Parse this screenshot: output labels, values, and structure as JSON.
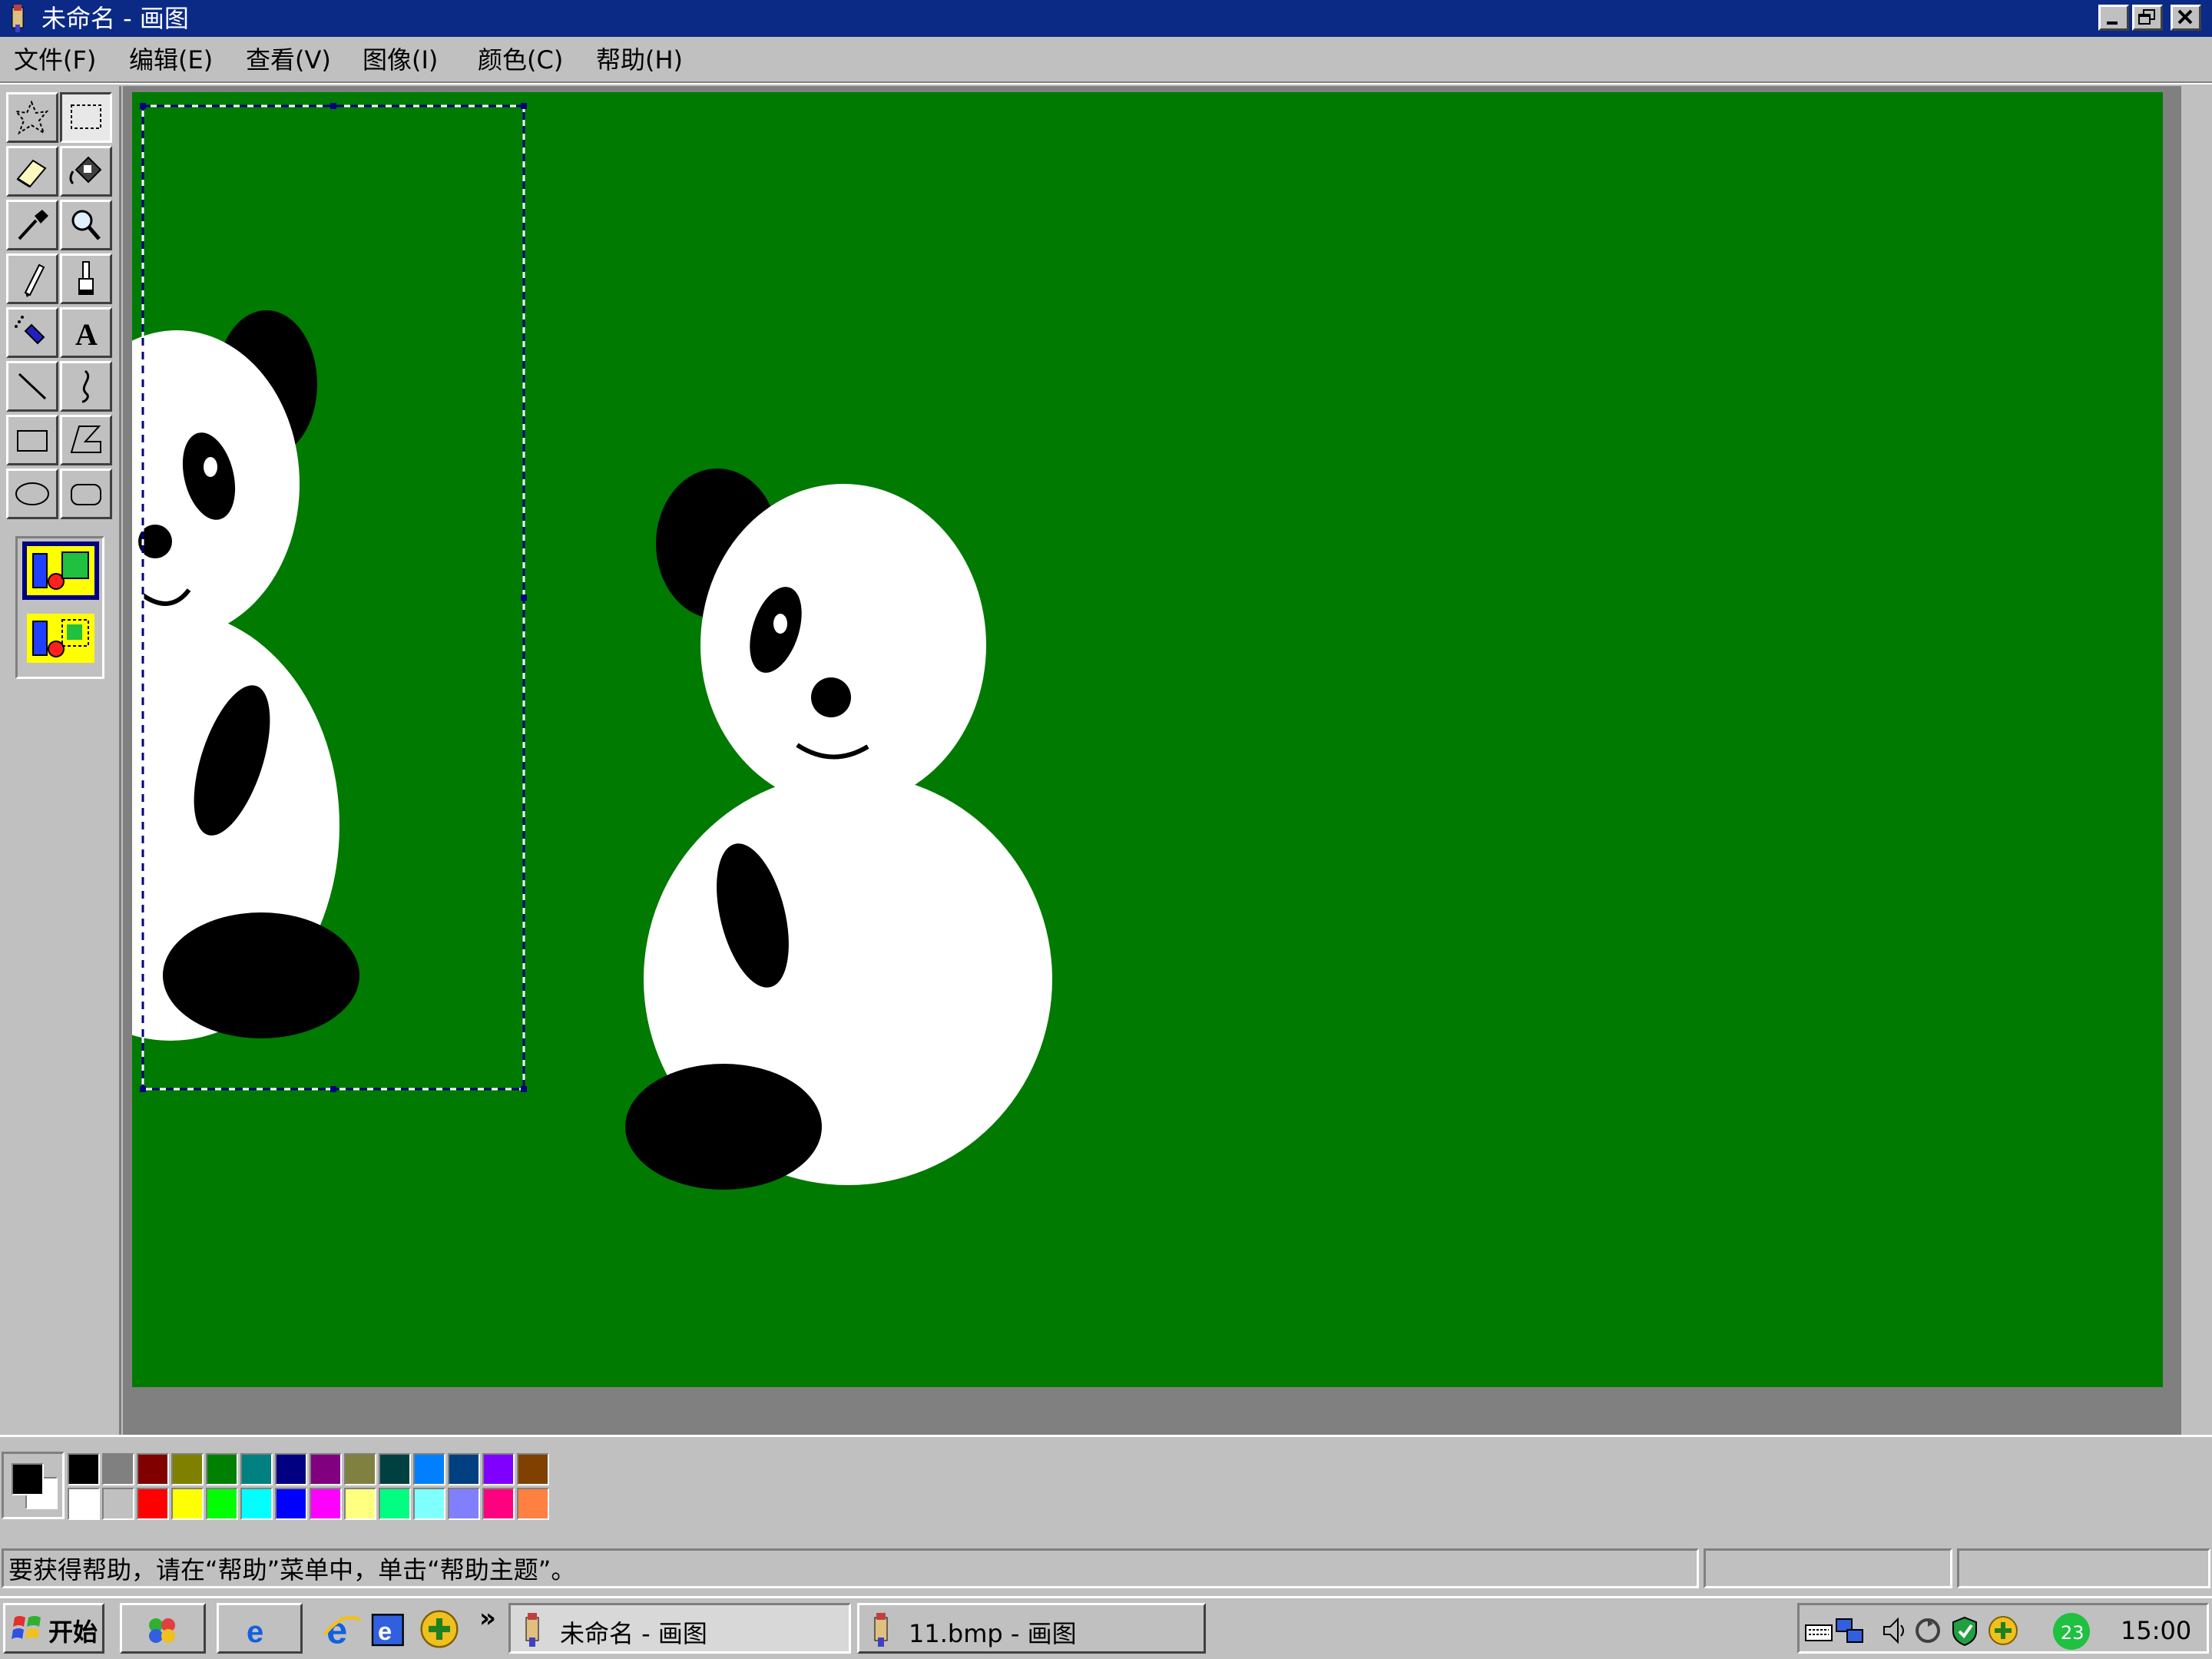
{
  "window": {
    "title": "未命名 - 画图"
  },
  "menu": [
    "文件(F)",
    "编辑(E)",
    "查看(V)",
    "图像(I)",
    "颜色(C)",
    "帮助(H)"
  ],
  "tools": [
    {
      "name": "free-form-select",
      "icon": "free-form-select-icon"
    },
    {
      "name": "rectangle-select",
      "icon": "rectangle-select-icon",
      "active": true
    },
    {
      "name": "eraser",
      "icon": "eraser-icon"
    },
    {
      "name": "fill-with-color",
      "icon": "paint-bucket-icon"
    },
    {
      "name": "pick-color",
      "icon": "eyedropper-icon"
    },
    {
      "name": "magnifier",
      "icon": "magnifier-icon"
    },
    {
      "name": "pencil",
      "icon": "pencil-icon"
    },
    {
      "name": "brush",
      "icon": "brush-icon"
    },
    {
      "name": "airbrush",
      "icon": "airbrush-icon"
    },
    {
      "name": "text",
      "icon": "text-icon",
      "glyph": "A"
    },
    {
      "name": "line",
      "icon": "line-icon"
    },
    {
      "name": "curve",
      "icon": "curve-icon"
    },
    {
      "name": "rectangle",
      "icon": "rectangle-icon"
    },
    {
      "name": "polygon",
      "icon": "polygon-icon"
    },
    {
      "name": "ellipse",
      "icon": "ellipse-icon"
    },
    {
      "name": "rounded-rectangle",
      "icon": "rounded-rectangle-icon"
    }
  ],
  "tool_options": [
    "opaque-selection-icon",
    "transparent-selection-icon"
  ],
  "canvas": {
    "background": "#007a00",
    "selection": "dashed rectangle selection"
  },
  "palette": {
    "foreground": "#000000",
    "background": "#ffffff",
    "top": [
      "#000000",
      "#808080",
      "#800000",
      "#808000",
      "#008000",
      "#008080",
      "#000080",
      "#800080",
      "#808040",
      "#004040",
      "#0080ff",
      "#004080",
      "#8000ff",
      "#804000"
    ],
    "bottom": [
      "#ffffff",
      "#c0c0c0",
      "#ff0000",
      "#ffff00",
      "#00ff00",
      "#00ffff",
      "#0000ff",
      "#ff00ff",
      "#ffff80",
      "#00ff80",
      "#80ffff",
      "#8080ff",
      "#ff0080",
      "#ff8040"
    ]
  },
  "status": {
    "text": "要获得帮助，请在“帮助”菜单中，单击“帮助主题”。"
  },
  "taskbar": {
    "start": "开始",
    "arrows": "»",
    "tasks": [
      {
        "label": "未命名 - 画图",
        "active": true
      },
      {
        "label": "11.bmp - 画图",
        "active": false
      }
    ],
    "tray_badge": "23",
    "clock": "15:00"
  }
}
